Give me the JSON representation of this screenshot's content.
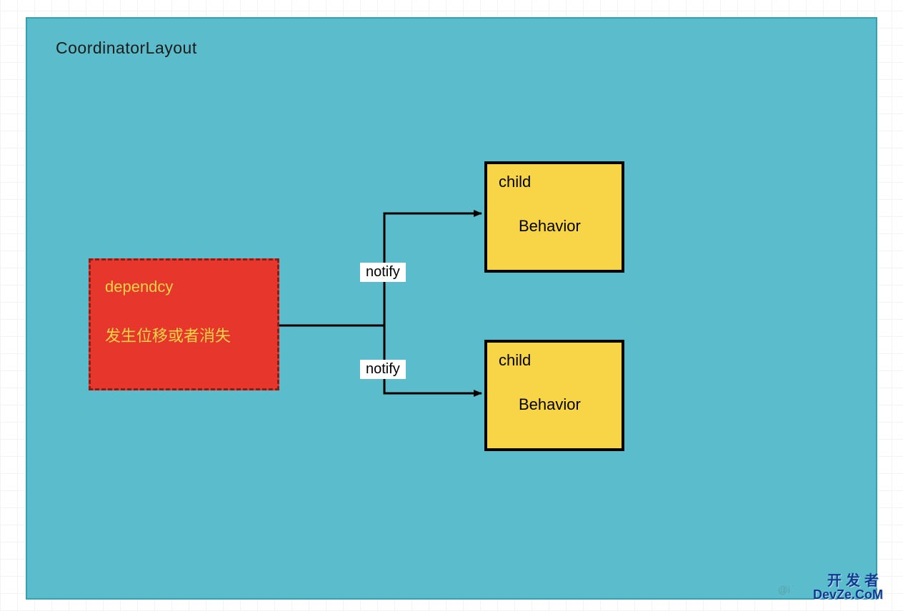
{
  "container": {
    "title": "CoordinatorLayout"
  },
  "dependency": {
    "label": "dependcy",
    "subtitle": "发生位移或者消失"
  },
  "edges": {
    "label1": "notify",
    "label2": "notify"
  },
  "children": [
    {
      "title": "child",
      "inner": "Behavior"
    },
    {
      "title": "child",
      "inner": "Behavior"
    }
  ],
  "watermark": {
    "line1": "开发者",
    "line2": "DevZe.CoM",
    "credit": "@i"
  },
  "colors": {
    "canvas": "#5BBCCB",
    "dependency": "#E7362B",
    "child": "#F8D546"
  }
}
